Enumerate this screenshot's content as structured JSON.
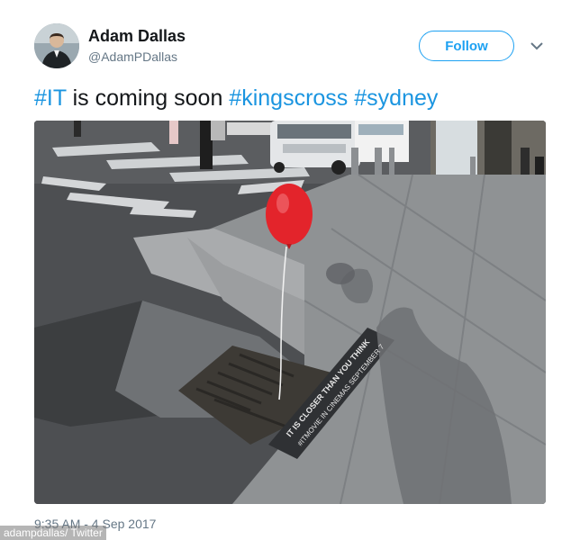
{
  "user": {
    "name": "Adam Dallas",
    "handle": "@AdamPDallas"
  },
  "follow_button": {
    "label": "Follow"
  },
  "tweet": {
    "segments": [
      {
        "text": "#IT",
        "hashtag": true
      },
      {
        "text": " is coming soon ",
        "hashtag": false
      },
      {
        "text": "#kingscross",
        "hashtag": true
      },
      {
        "text": " ",
        "hashtag": false
      },
      {
        "text": "#sydney",
        "hashtag": true
      }
    ],
    "timestamp": "9:35 AM - 4 Sep 2017"
  },
  "photo": {
    "plaque_line1": "IT IS CLOSER THAN YOU THINK",
    "plaque_line2": "#ITMOVIE IN CINEMAS SEPTEMBER 7",
    "balloon_color": "#e3242b"
  },
  "credit": "adampdallas/ Twitter",
  "colors": {
    "accent": "#1da1f2",
    "hashtag": "#1b95e0",
    "text": "#14171a",
    "muted": "#657786"
  }
}
